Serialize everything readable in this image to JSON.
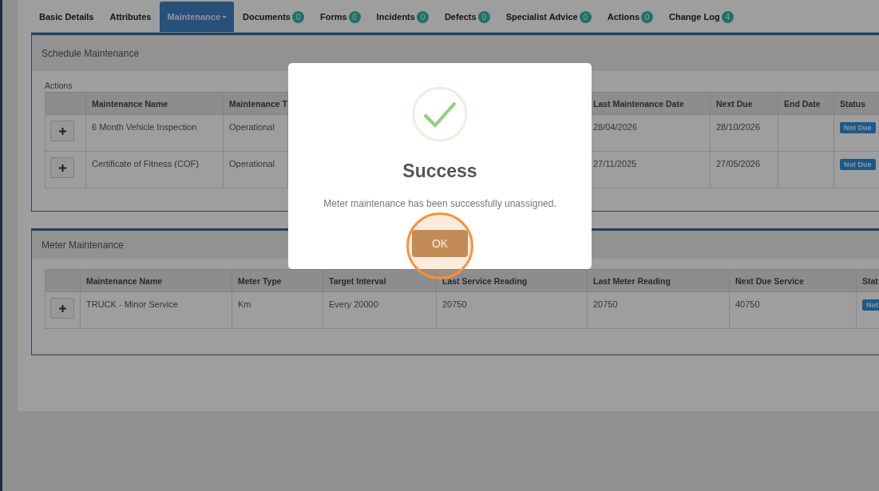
{
  "tabs": [
    {
      "label": "Basic Details",
      "selected": false,
      "has_menu": false
    },
    {
      "label": "Attributes",
      "selected": false,
      "has_menu": false
    },
    {
      "label": "Maintenance",
      "selected": true,
      "has_menu": true
    },
    {
      "label": "Documents",
      "badge": "0",
      "selected": false,
      "has_menu": false
    },
    {
      "label": "Forms",
      "badge": "0",
      "selected": false,
      "has_menu": false
    },
    {
      "label": "Incidents",
      "badge": "0",
      "selected": false,
      "has_menu": false
    },
    {
      "label": "Defects",
      "badge": "0",
      "selected": false,
      "has_menu": false
    },
    {
      "label": "Specialist Advice",
      "badge": "0",
      "selected": false,
      "has_menu": false
    },
    {
      "label": "Actions",
      "badge": "0",
      "selected": false,
      "has_menu": false
    },
    {
      "label": "Change Log",
      "badge": "4",
      "selected": false,
      "has_menu": false
    }
  ],
  "schedule_maintenance": {
    "title": "Schedule Maintenance",
    "actions_label": "Actions",
    "columns": {
      "name": "Maintenance Name",
      "type": "Maintenance T",
      "last_date": "Last Maintenance Date",
      "next_due": "Next Due",
      "end_date": "End Date",
      "status": "Status"
    },
    "rows": [
      {
        "name": "6 Month Vehicle Inspection",
        "type": "Operational",
        "last_date": "28/04/2026",
        "next_due": "28/10/2026",
        "status": "Not Due"
      },
      {
        "name": "Certificate of Fitness (COF)",
        "type": "Operational",
        "last_date": "27/11/2025",
        "next_due": "27/05/2026",
        "status": "Not Due"
      }
    ]
  },
  "meter_maintenance": {
    "title": "Meter Maintenance",
    "columns": {
      "name": "Maintenance Name",
      "meter_type": "Meter Type",
      "target_interval": "Target Interval",
      "last_service_reading": "Last Service Reading",
      "last_meter_reading": "Last Meter Reading",
      "next_due_service": "Next Due Service",
      "status": "Stat"
    },
    "rows": [
      {
        "name": "TRUCK - Minor Service",
        "meter_type": "Km",
        "target_interval": "Every 20000",
        "last_service_reading": "20750",
        "last_meter_reading": "20750",
        "next_due_service": "40750",
        "status": "Not"
      }
    ]
  },
  "dialog": {
    "title": "Success",
    "message": "Meter maintenance has been successfully unassigned.",
    "button": "OK",
    "highlighted": true
  }
}
